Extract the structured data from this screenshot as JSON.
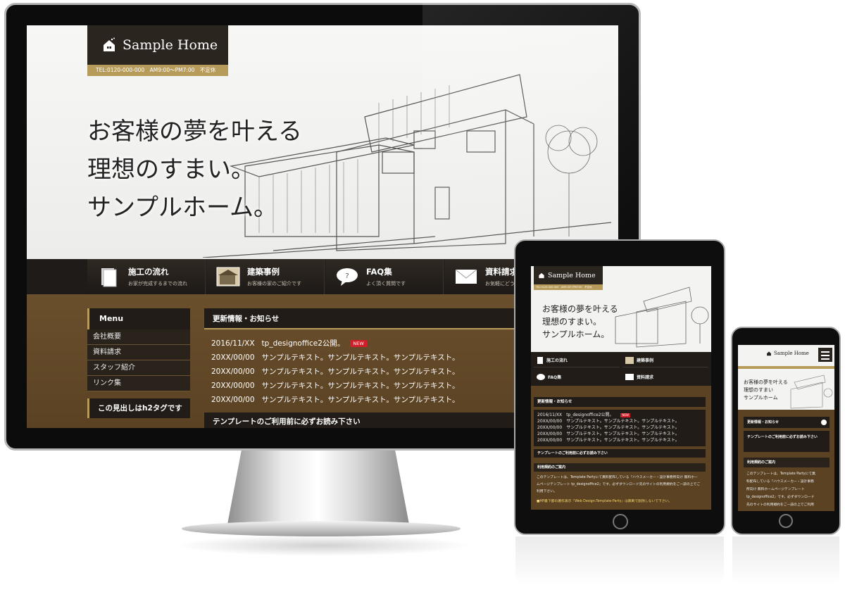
{
  "site": {
    "logo_text": "Sample Home",
    "tel": "TEL:0120-000-000　AM9:00〜PM7:00　不定休",
    "tel_short": "TEL:0120-000-000　AM9:00〜PM7:00　不定休",
    "catch_lines": [
      "お客様の夢を叶える",
      "理想のすまい。",
      "サンプルホーム。"
    ],
    "catch_short": [
      "お客様の夢を叶える",
      "理想のすまい",
      "サンプルホーム"
    ]
  },
  "nav": [
    {
      "title": "施工の流れ",
      "sub": "お家が完成するまでの流れ",
      "icon": "document-stack-icon"
    },
    {
      "title": "建築事例",
      "sub": "お客様の家のご紹介です",
      "icon": "house-photo-icon"
    },
    {
      "title": "FAQ集",
      "sub": "よく頂く質問です",
      "icon": "question-bubble-icon"
    },
    {
      "title": "資料請求",
      "sub": "お気軽にどうぞ",
      "icon": "envelope-icon"
    }
  ],
  "sidebar": {
    "heading": "Menu",
    "items": [
      "会社概要",
      "資料請求",
      "スタッフ紹介",
      "リンク集"
    ],
    "h2_heading": "この見出しはh2タグです"
  },
  "news": {
    "heading": "更新情報・お知らせ",
    "badge": "NEW",
    "rows": [
      {
        "date": "2016/11/XX",
        "text": "tp_designoffice2公開。"
      },
      {
        "date": "20XX/00/00",
        "text": "サンプルテキスト。サンプルテキスト。サンプルテキスト。"
      },
      {
        "date": "20XX/00/00",
        "text": "サンプルテキスト。サンプルテキスト。サンプルテキスト。"
      },
      {
        "date": "20XX/00/00",
        "text": "サンプルテキスト。サンプルテキスト。サンプルテキスト。"
      },
      {
        "date": "20XX/00/00",
        "text": "サンプルテキスト。サンプルテキスト。サンプルテキスト。"
      }
    ]
  },
  "notice": {
    "heading": "テンプレートのご利用前に必ずお読み下さい",
    "sub_heading": "利用規約のご案内",
    "body_tablet": [
      "このテンプレートは、Template Partyにて無料配布している『ハウスメーカー・設計事務所向け 無料ホー",
      "ムページテンプレート tp_designoffice2』です。必ずダウンロード先のサイトの利用規約をご一読の上でご",
      "利用下さい。"
    ],
    "warn_tablet": "■HP最下部の著作表示『Web Design:Template-Party』は無断で削除しないで下さい。",
    "body_phone": [
      "このテンプレートは、Template Partyにて無",
      "料配布している『ハウスメーカー・設計事務",
      "所向け 無料ホームページテンプレート",
      "tp_designoffice2』です。必ずダウンロード",
      "先のサイトの利用規約をご一読の上でご利用"
    ]
  },
  "colors": {
    "brown_bg": "#5a4223",
    "dark_bar": "#211c17",
    "gold": "#b79b5a",
    "new_badge": "#d01f2a"
  }
}
